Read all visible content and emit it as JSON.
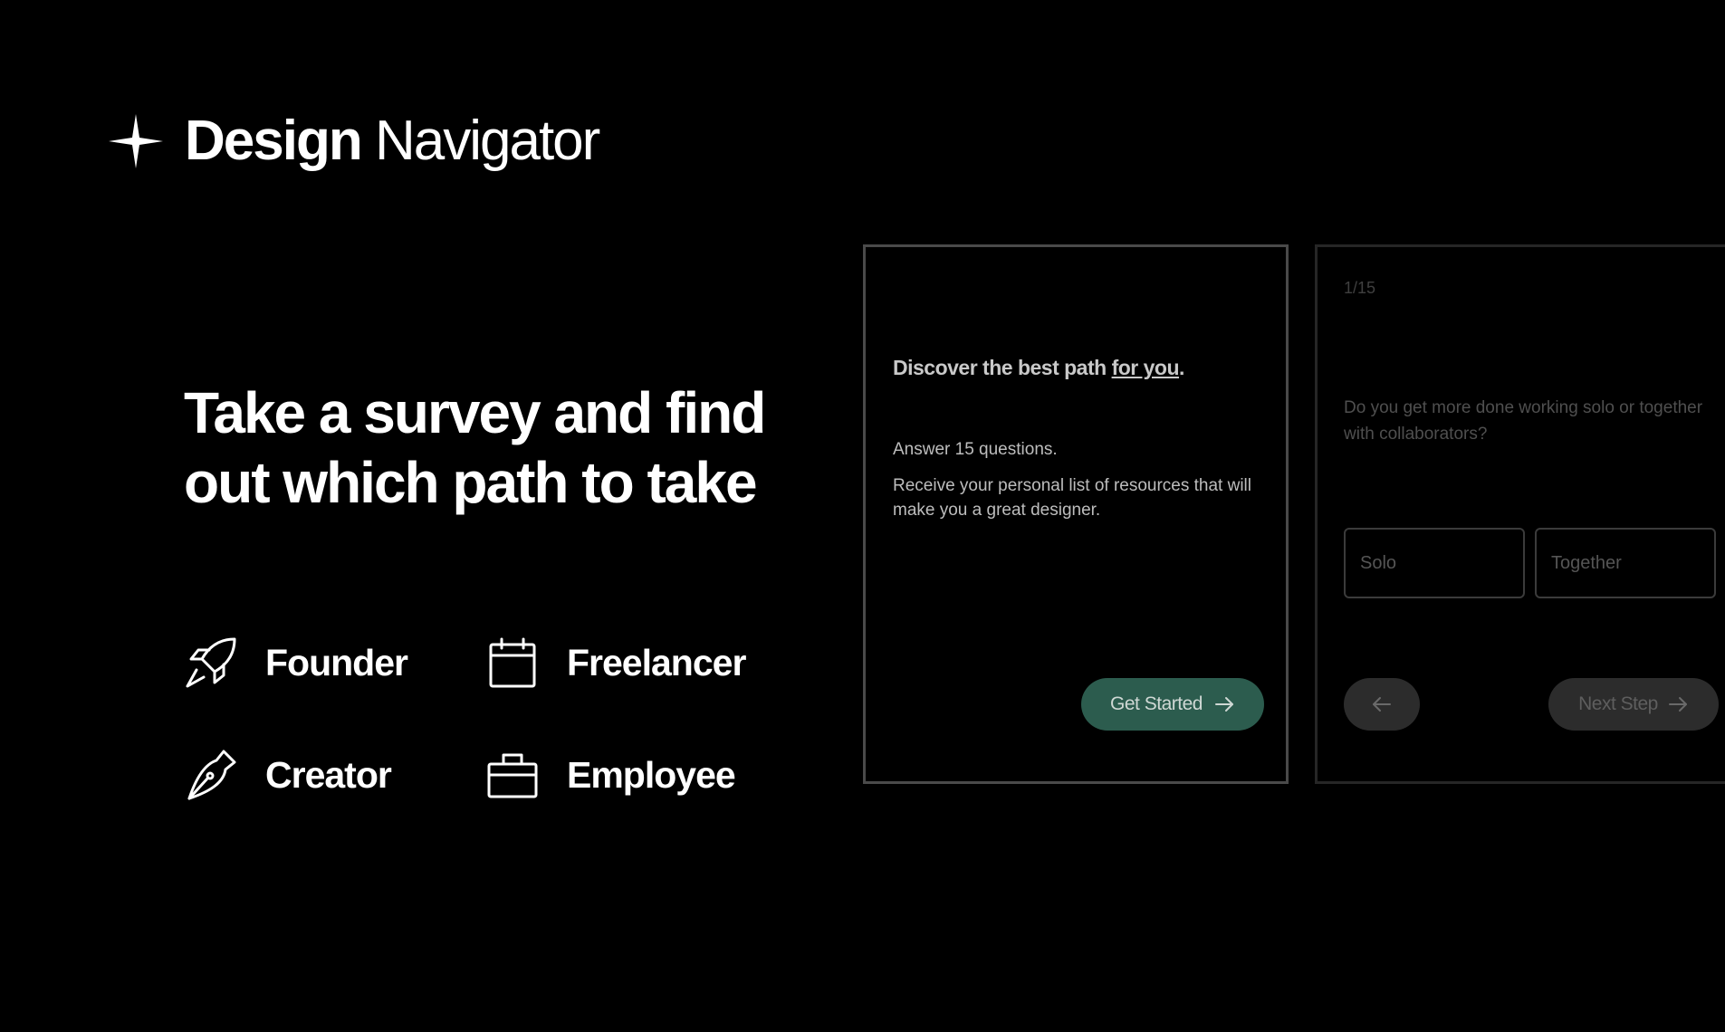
{
  "brand": {
    "icon": "four-point-star-icon",
    "name_bold": "Design",
    "name_light": "Navigator"
  },
  "hero": {
    "headline_line1": "Take a survey and find",
    "headline_line2": "out which path to take"
  },
  "roles": [
    {
      "label": "Founder",
      "icon": "rocket-icon"
    },
    {
      "label": "Freelancer",
      "icon": "calendar-icon"
    },
    {
      "label": "Creator",
      "icon": "pen-nib-icon"
    },
    {
      "label": "Employee",
      "icon": "briefcase-icon"
    }
  ],
  "intro_card": {
    "title_prefix": "Discover the best path ",
    "title_accent": "for you",
    "title_suffix": ".",
    "line1": "Answer 15 questions.",
    "line2": "Receive your personal list of resources that will make you a great designer.",
    "button_label": "Get Started",
    "button_color": "#2c5c4e"
  },
  "question_card": {
    "progress": "1/15",
    "question": "Do you get more done working solo or together with collaborators?",
    "options": [
      "Solo",
      "Together"
    ],
    "next_label": "Next Step"
  }
}
